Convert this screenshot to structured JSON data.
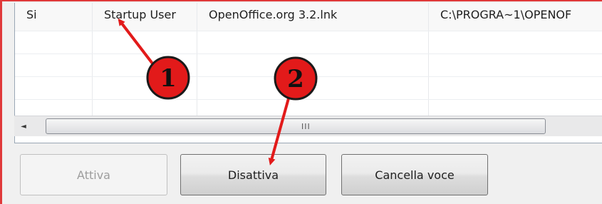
{
  "table": {
    "rows": [
      [
        "Si",
        "Startup User",
        "OpenOffice.org 3.2.lnk",
        "C:\\PROGRA~1\\OPENOF"
      ],
      [
        "",
        "",
        "",
        ""
      ],
      [
        "",
        "",
        "",
        ""
      ],
      [
        "",
        "",
        "",
        ""
      ],
      [
        "",
        "",
        "",
        ""
      ]
    ]
  },
  "scrollbar": {
    "left_arrow": "◄",
    "grip": "III"
  },
  "buttons": {
    "enable": "Attiva",
    "disable": "Disattiva",
    "delete": "Cancella voce"
  },
  "annotations": {
    "badge1": "1",
    "badge2": "2",
    "color": "#e21a1a"
  }
}
